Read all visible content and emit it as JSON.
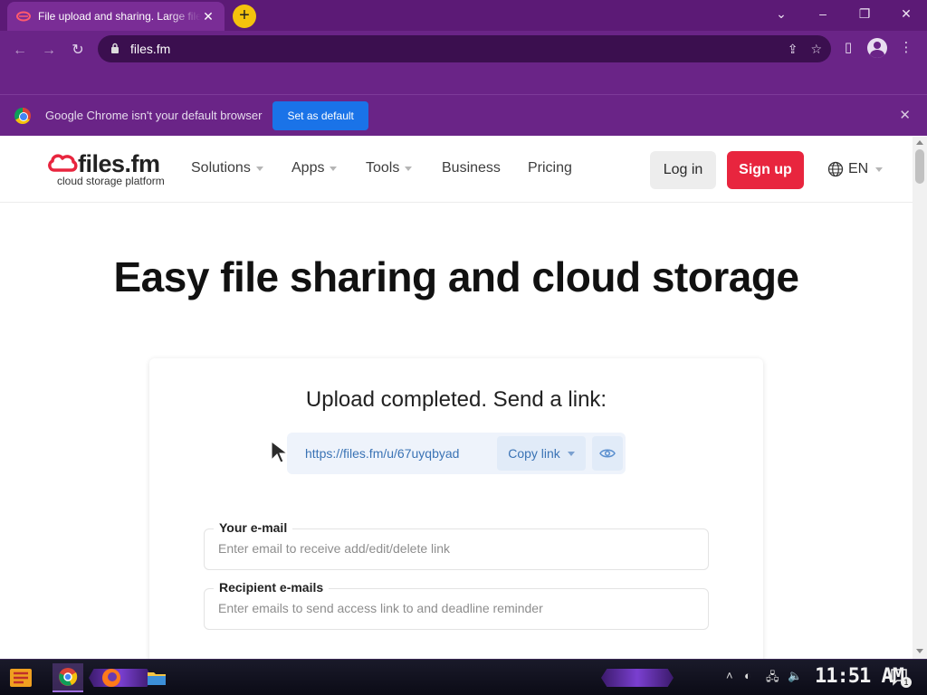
{
  "browser": {
    "tab_title": "File upload and sharing. Large files",
    "url": "files.fm",
    "infobar_text": "Google Chrome isn't your default browser",
    "set_default_label": "Set as default"
  },
  "site": {
    "logo_word": "files.fm",
    "logo_tagline": "cloud storage platform",
    "nav": [
      "Solutions",
      "Apps",
      "Tools",
      "Business",
      "Pricing"
    ],
    "login_label": "Log in",
    "signup_label": "Sign up",
    "language": "EN"
  },
  "hero_title": "Easy file sharing and cloud storage",
  "upload": {
    "heading": "Upload completed. Send a link:",
    "link_url": "https://files.fm/u/67uyqbyad",
    "copy_label": "Copy link"
  },
  "form": {
    "email_label": "Your e-mail",
    "email_placeholder": "Enter email to receive add/edit/delete link",
    "recipients_label": "Recipient e-mails",
    "recipients_placeholder": "Enter emails to send access link to and deadline reminder"
  },
  "taskbar": {
    "clock": "11:51 AM",
    "notification_count": "1"
  },
  "colors": {
    "browser_frame": "#6a2487",
    "signup_red": "#e8253e",
    "link_blue": "#3a73b5",
    "set_default_blue": "#1a73e8"
  }
}
